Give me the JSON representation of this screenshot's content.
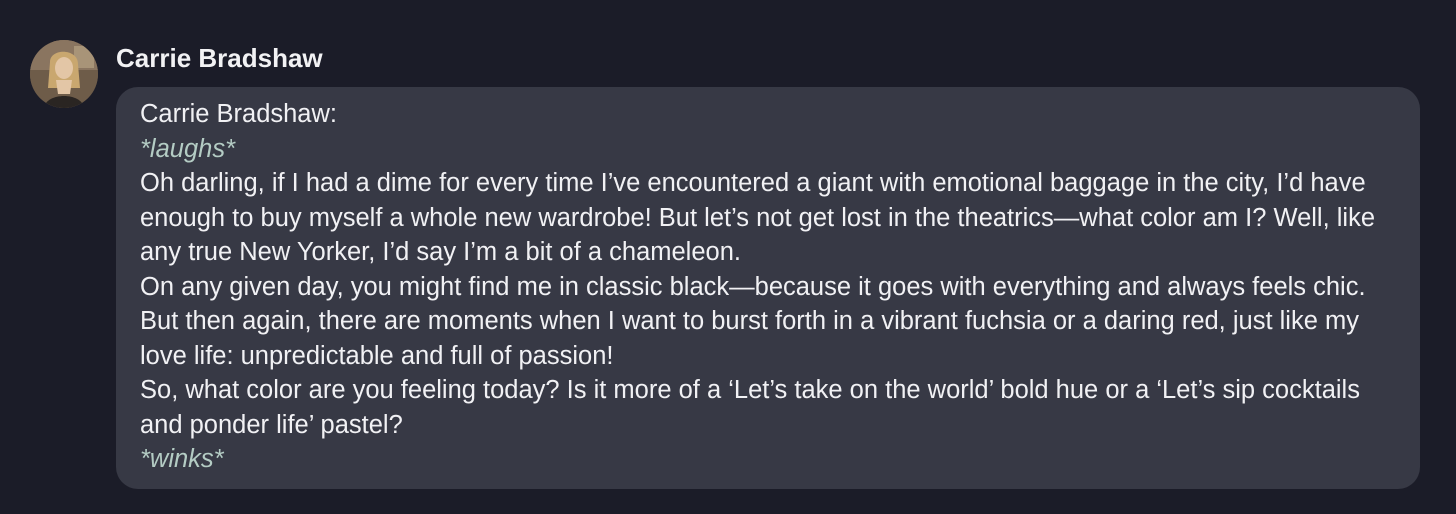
{
  "message": {
    "author": "Carrie Bradshaw",
    "avatar_icon": "user-avatar-photo",
    "colors": {
      "background": "#1b1c28",
      "bubble": "#373945",
      "text": "#f1f1f4",
      "action_text": "#b4ccc4"
    },
    "body": {
      "speaker_line": "Carrie Bradshaw:",
      "action_1": "*laughs*",
      "paragraph_1": "Oh darling, if I had a dime for every time I’ve encountered a giant with emotional baggage in the city, I’d have enough to buy myself a whole new wardrobe! But let’s not get lost in the theatrics—what color am I? Well, like any true New Yorker, I’d say I’m a bit of a chameleon.",
      "paragraph_2": "On any given day, you might find me in classic black—because it goes with everything and always feels chic. But then again, there are moments when I want to burst forth in a vibrant fuchsia or a daring red, just like my love life: unpredictable and full of passion!",
      "paragraph_3": "So, what color are you feeling today? Is it more of a ‘Let’s take on the world’ bold hue or a ‘Let’s sip cocktails and ponder life’ pastel?",
      "action_2": "*winks*"
    }
  }
}
